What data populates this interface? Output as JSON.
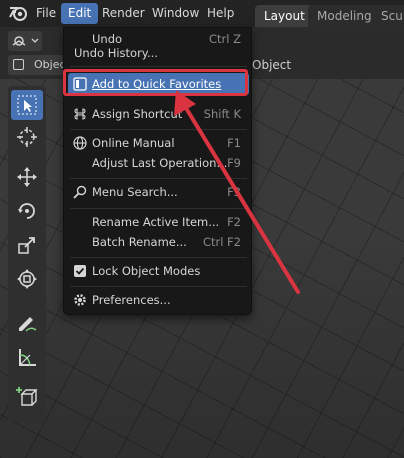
{
  "menubar": {
    "items": [
      {
        "label": "File"
      },
      {
        "label": "Edit"
      },
      {
        "label": "Render"
      },
      {
        "label": "Window"
      },
      {
        "label": "Help"
      }
    ],
    "workspaces": [
      "Layout",
      "Modeling",
      "Scul"
    ]
  },
  "header": {
    "object_mode_label": "Objec",
    "object_menu_label": "Object"
  },
  "edit_menu": {
    "undo": {
      "label": "Undo",
      "shortcut": "Ctrl Z"
    },
    "undo_history": {
      "label": "Undo History..."
    },
    "add_to_quick_favorites": {
      "label": "Add to Quick Favorites"
    },
    "assign_shortcut": {
      "label": "Assign Shortcut",
      "shortcut": "Shift K"
    },
    "online_manual": {
      "label": "Online Manual",
      "shortcut": "F1"
    },
    "adjust_last_operation": {
      "label": "Adjust Last Operation...",
      "shortcut": "F9"
    },
    "menu_search": {
      "label": "Menu Search...",
      "shortcut": "F3"
    },
    "rename_active_item": {
      "label": "Rename Active Item...",
      "shortcut": "F2"
    },
    "batch_rename": {
      "label": "Batch Rename...",
      "shortcut": "Ctrl F2"
    },
    "lock_object_modes": {
      "label": "Lock Object Modes",
      "checked": true
    },
    "preferences": {
      "label": "Preferences..."
    }
  },
  "colors": {
    "accent": "#4772b3",
    "annotation": "#d9343f",
    "menu_bg": "#181818"
  },
  "icons": [
    "blender-logo",
    "select-box-icon",
    "cursor-icon",
    "move-icon",
    "rotate-icon",
    "scale-icon",
    "transform-icon",
    "annotate-icon",
    "measure-icon",
    "add-cube-icon"
  ]
}
